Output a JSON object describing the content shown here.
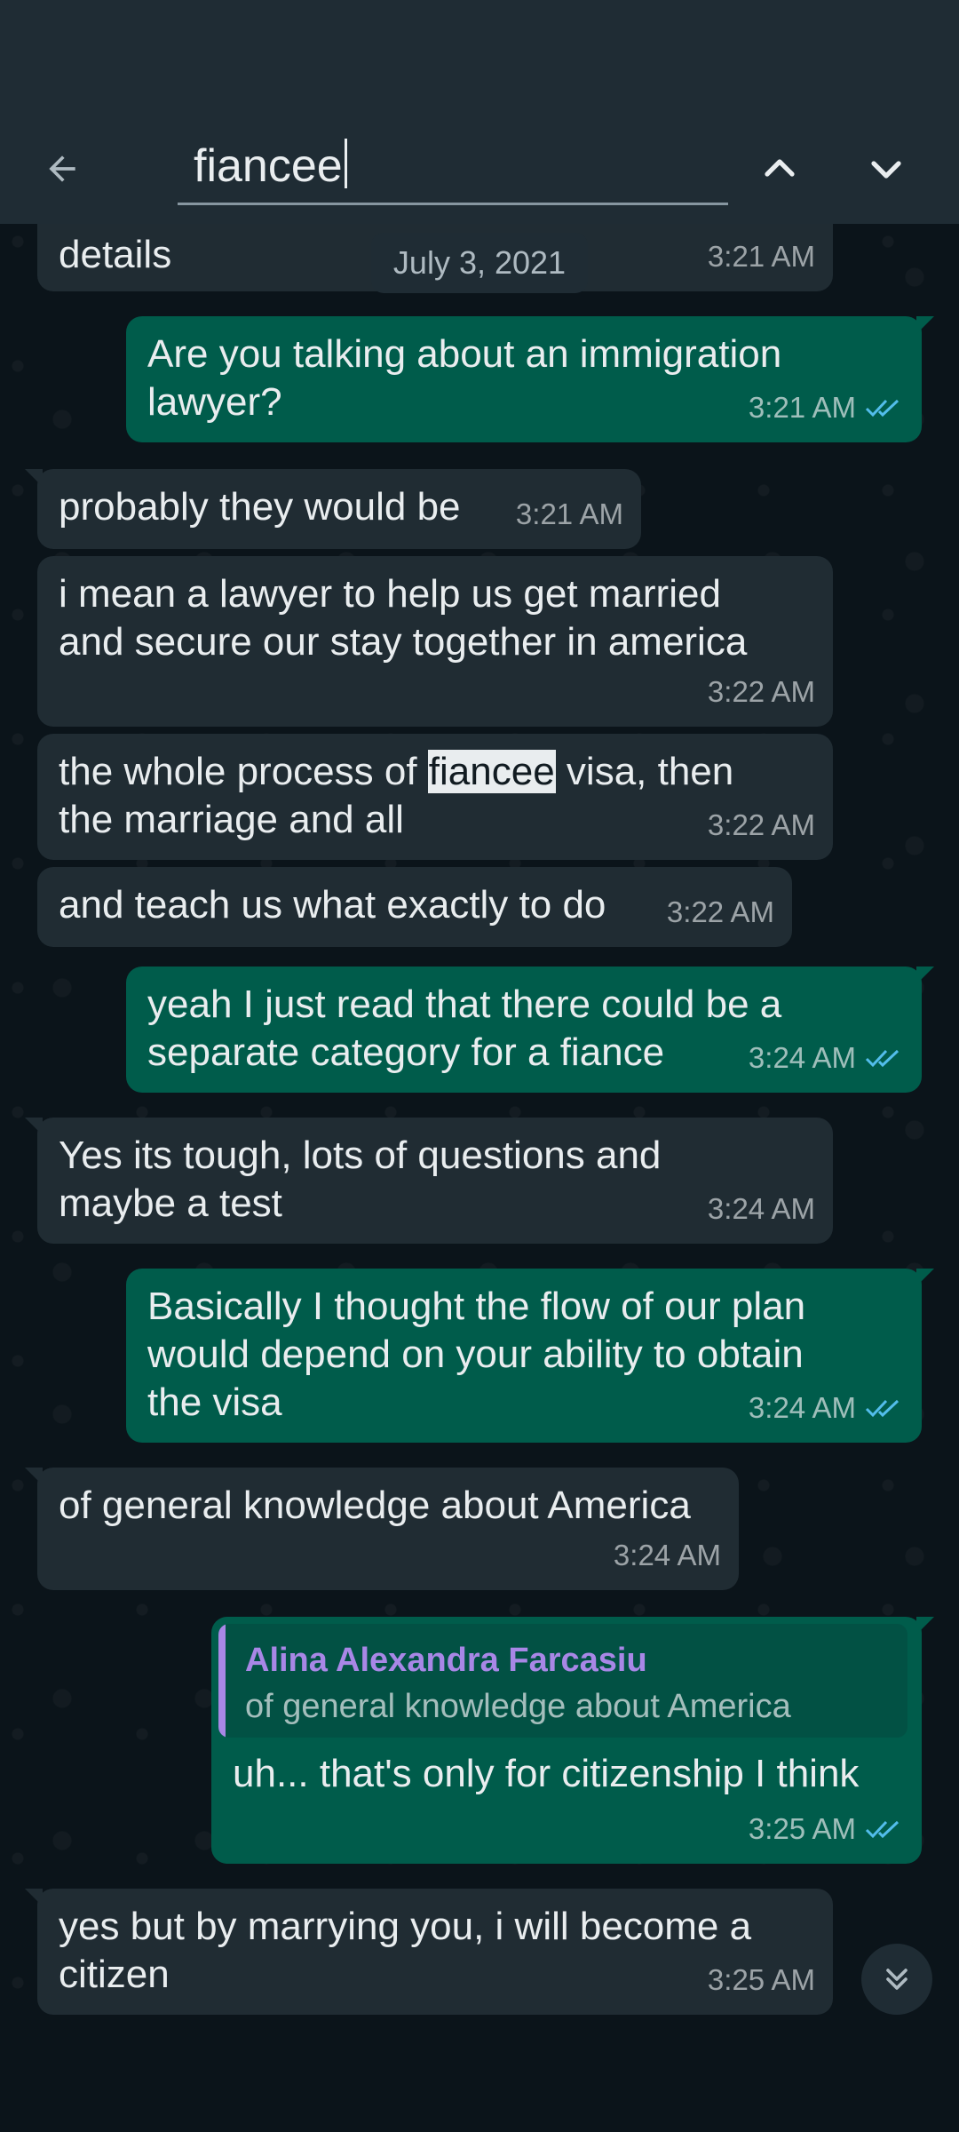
{
  "search": {
    "query": "fiancee"
  },
  "date_chip": "July 3, 2021",
  "messages": [
    {
      "dir": "in",
      "lines": [
        "details"
      ],
      "time": "3:21 AM"
    },
    {
      "dir": "out",
      "lines": [
        "Are you talking about an immigration",
        "lawyer?"
      ],
      "time": "3:21 AM",
      "status": "read"
    },
    {
      "dir": "in",
      "lines": [
        "probably they would be"
      ],
      "time": "3:21 AM"
    },
    {
      "dir": "in",
      "lines": [
        "i mean a lawyer to help us get married",
        "and secure our stay together in america"
      ],
      "time": "3:22 AM"
    },
    {
      "dir": "in",
      "before": "the whole process of ",
      "highlight": "fiancee",
      "after": " visa, then",
      "line2": "the marriage and all",
      "time": "3:22 AM"
    },
    {
      "dir": "in",
      "lines": [
        "and teach us what exactly to do"
      ],
      "time": "3:22 AM"
    },
    {
      "dir": "out",
      "lines": [
        "yeah I just read that there could be a",
        "separate category for a fiance"
      ],
      "time": "3:24 AM",
      "status": "read"
    },
    {
      "dir": "in",
      "lines": [
        "Yes its tough, lots of questions and",
        "maybe a test"
      ],
      "time": "3:24 AM"
    },
    {
      "dir": "out",
      "lines": [
        "Basically I thought the flow of our plan",
        "would depend on your ability to obtain",
        "the visa"
      ],
      "time": "3:24 AM",
      "status": "read"
    },
    {
      "dir": "in",
      "lines": [
        "of general knowledge about America"
      ],
      "time": "3:24 AM"
    },
    {
      "dir": "out",
      "quote": {
        "author": "Alina Alexandra Farcasiu",
        "text": "of general knowledge about America"
      },
      "lines": [
        "uh...  that's only for citizenship I think"
      ],
      "time": "3:25 AM",
      "status": "read"
    },
    {
      "dir": "in",
      "lines": [
        "yes but by marrying you, i will become a",
        "citizen"
      ],
      "time": "3:25 AM"
    }
  ],
  "icons": {
    "back": "back-arrow-icon",
    "up": "chevron-up-icon",
    "down": "chevron-down-icon",
    "scroll": "double-chevron-down-icon",
    "read": "double-check-icon"
  },
  "colors": {
    "accent_read_tick": "#53bdeb",
    "outgoing_bubble": "#005c4b",
    "incoming_bubble": "#202c33",
    "quote_author": "#a887e6",
    "header": "#1f2c34"
  }
}
